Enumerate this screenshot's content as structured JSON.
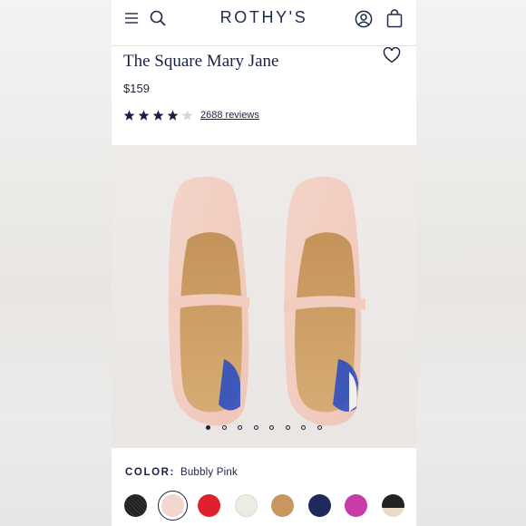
{
  "header": {
    "logo": "ROTHY'S",
    "icons": [
      "menu-icon",
      "search-icon",
      "account-icon",
      "bag-icon"
    ]
  },
  "product": {
    "title": "The Square Mary Jane",
    "price": "$159",
    "rating_stars": 4,
    "rating_max": 5,
    "reviews_link": "2688 reviews",
    "wishlist_icon": "heart-outline-icon"
  },
  "gallery": {
    "image_count": 8,
    "active_index": 0,
    "image_alt": "Pair of light pink knit square-toe Mary Jane flats with tan insoles"
  },
  "color": {
    "label": "COLOR:",
    "value": "Bubbly Pink",
    "selected_index": 1,
    "swatches": [
      {
        "name": "black-knit",
        "color": "#1f1f1f"
      },
      {
        "name": "bubbly-pink",
        "color": "#f3d6cd"
      },
      {
        "name": "red",
        "color": "#e0202e"
      },
      {
        "name": "cream",
        "color": "#ecebe4"
      },
      {
        "name": "camel",
        "color": "#c9965f"
      },
      {
        "name": "navy",
        "color": "#1e2a5c"
      },
      {
        "name": "magenta",
        "color": "#c93ba7"
      },
      {
        "name": "black-cream",
        "color": "#232323"
      }
    ]
  },
  "colors": {
    "brand": "#1e2a4a",
    "text": "#1a2244",
    "star": "#1a2244",
    "star_empty": "#d6d6d6"
  }
}
